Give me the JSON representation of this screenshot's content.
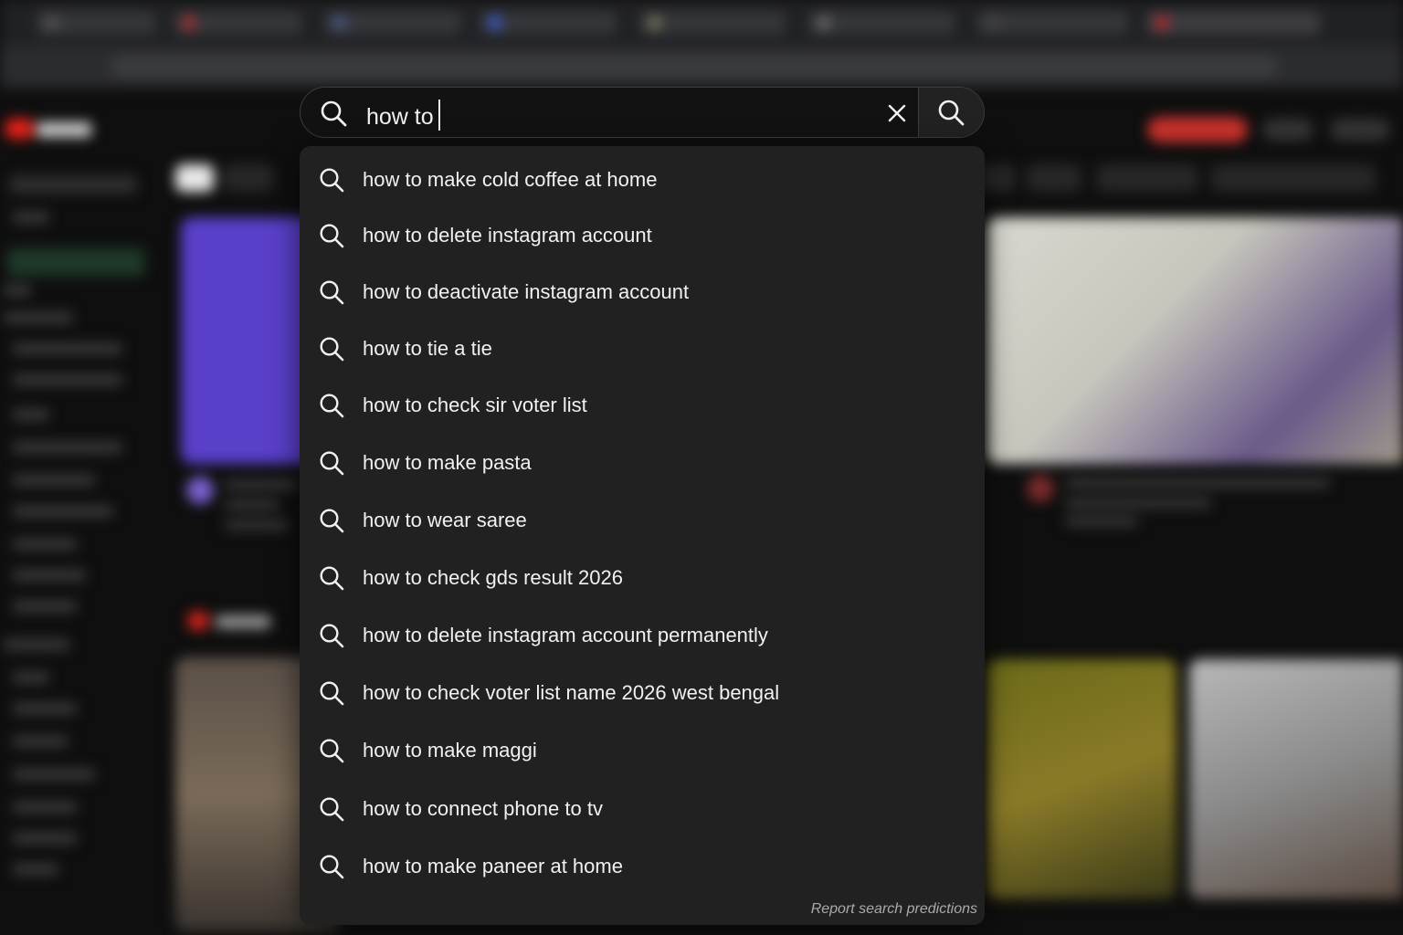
{
  "search": {
    "query": "how to",
    "search_button_icon": "search-icon",
    "clear_button_icon": "close-icon"
  },
  "suggestions": [
    {
      "text": "how to make cold coffee at home"
    },
    {
      "text": "how to delete instagram account"
    },
    {
      "text": "how to deactivate instagram account"
    },
    {
      "text": "how to tie a tie"
    },
    {
      "text": "how to check sir voter list"
    },
    {
      "text": "how to make pasta"
    },
    {
      "text": "how to wear saree"
    },
    {
      "text": "how to check gds result 2026"
    },
    {
      "text": "how to delete instagram account permanently"
    },
    {
      "text": "how to check voter list name 2026 west bengal"
    },
    {
      "text": "how to make maggi"
    },
    {
      "text": "how to connect phone to tv"
    },
    {
      "text": "how to make paneer at home"
    }
  ],
  "report_link": "Report search predictions",
  "colors": {
    "page_background": "#0f0f0f",
    "dropdown_background": "#212121",
    "searchbar_background": "#121212",
    "text_primary": "#f1f1f1",
    "text_secondary": "#aaaaaa"
  }
}
